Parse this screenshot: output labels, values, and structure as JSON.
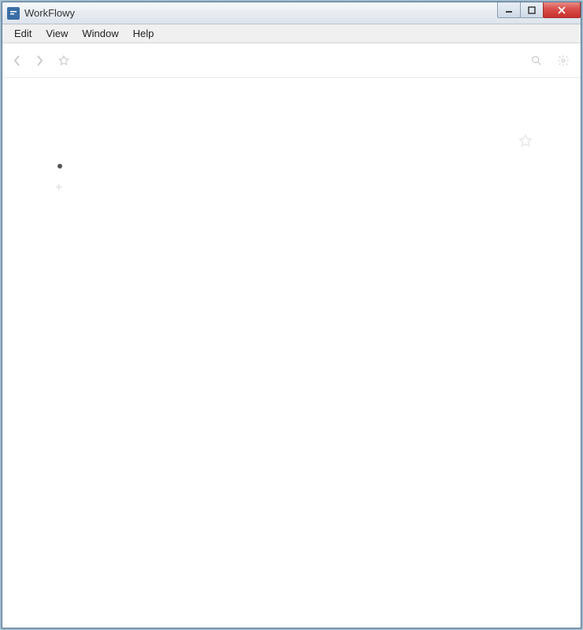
{
  "titlebar": {
    "app_name": "WorkFlowy"
  },
  "menubar": {
    "items": [
      "Edit",
      "View",
      "Window",
      "Help"
    ]
  },
  "toolbar": {
    "back": "back",
    "forward": "forward",
    "star": "star",
    "search": "search",
    "settings": "settings"
  },
  "content": {
    "bullet_text": "",
    "add_hint": "+"
  }
}
